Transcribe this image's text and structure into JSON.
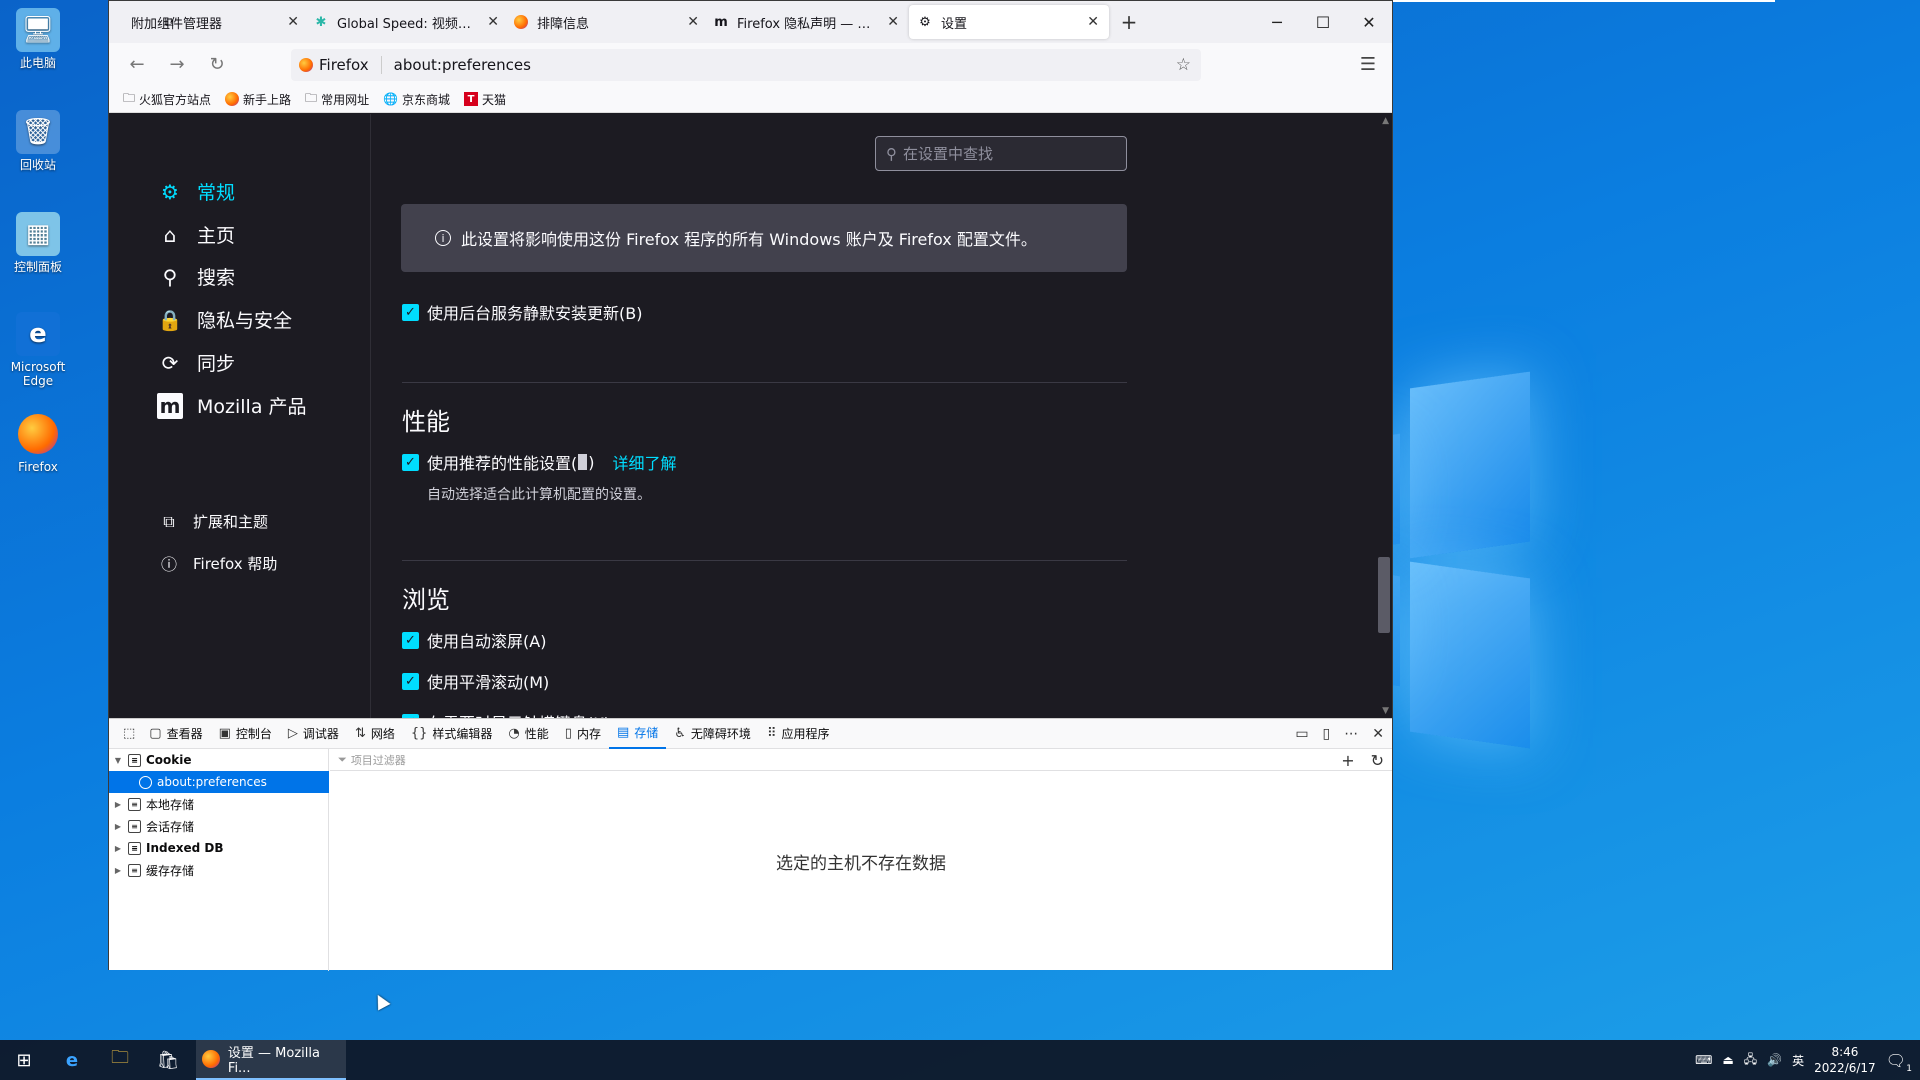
{
  "desktop": {
    "icons": [
      {
        "label": "此电脑",
        "icon": "computer-icon"
      },
      {
        "label": "回收站",
        "icon": "recycle-bin-icon"
      },
      {
        "label": "控制面板",
        "icon": "control-panel-icon"
      },
      {
        "label": "Microsoft Edge",
        "icon": "edge-icon"
      },
      {
        "label": "Firefox",
        "icon": "firefox-icon"
      }
    ]
  },
  "browser": {
    "tabs": [
      {
        "label": "附加组件管理器",
        "icon": "puzzle-icon"
      },
      {
        "label": "Global Speed: 视频速度控制",
        "icon": "global-speed-icon"
      },
      {
        "label": "排障信息",
        "icon": "firefox-icon"
      },
      {
        "label": "Firefox 隐私声明 — Mozilla",
        "icon": "mozilla-icon"
      },
      {
        "label": "设置",
        "icon": "gear-icon"
      }
    ],
    "url_identity": "Firefox",
    "url": "about:preferences",
    "bookmarks": [
      {
        "label": "火狐官方站点",
        "icon": "folder-icon"
      },
      {
        "label": "新手上路",
        "icon": "firefox-icon"
      },
      {
        "label": "常用网址",
        "icon": "folder-icon"
      },
      {
        "label": "京东商城",
        "icon": "globe-icon"
      },
      {
        "label": "天猫",
        "icon": "tmall-icon"
      }
    ]
  },
  "settings": {
    "nav": [
      {
        "label": "常规",
        "icon": "gear-icon",
        "active": true
      },
      {
        "label": "主页",
        "icon": "home-icon"
      },
      {
        "label": "搜索",
        "icon": "search-icon"
      },
      {
        "label": "隐私与安全",
        "icon": "lock-icon"
      },
      {
        "label": "同步",
        "icon": "sync-icon"
      },
      {
        "label": "Mozilla 产品",
        "icon": "mozilla-icon"
      }
    ],
    "nav_footer": [
      {
        "label": "扩展和主题",
        "icon": "puzzle-icon"
      },
      {
        "label": "Firefox 帮助",
        "icon": "help-icon"
      }
    ],
    "search_placeholder": "在设置中查找",
    "info_text": "此设置将影响使用这份 Firefox 程序的所有 Windows 账户及 Firefox 配置文件。",
    "bg_update_label": "使用后台服务静默安装更新(B)",
    "performance_title": "性能",
    "perf_recommended_label": "使用推荐的性能设置(",
    "perf_recommended_suffix": ")",
    "learn_more": "详细了解",
    "perf_subtext": "自动选择适合此计算机配置的设置。",
    "browsing_title": "浏览",
    "autoscroll_label": "使用自动滚屏(A)",
    "smooth_scroll_label": "使用平滑滚动(M)",
    "touch_keyboard_label": "在需要时显示触摸键盘(K)"
  },
  "devtools": {
    "tabs": [
      {
        "label": "查看器",
        "icon": "inspector-icon"
      },
      {
        "label": "控制台",
        "icon": "console-icon"
      },
      {
        "label": "调试器",
        "icon": "debugger-icon"
      },
      {
        "label": "网络",
        "icon": "network-icon"
      },
      {
        "label": "样式编辑器",
        "icon": "style-editor-icon"
      },
      {
        "label": "性能",
        "icon": "performance-icon"
      },
      {
        "label": "内存",
        "icon": "memory-icon"
      },
      {
        "label": "存储",
        "icon": "storage-icon",
        "active": true
      },
      {
        "label": "无障碍环境",
        "icon": "accessibility-icon"
      },
      {
        "label": "应用程序",
        "icon": "application-icon"
      }
    ],
    "tree": [
      {
        "label": "Cookie",
        "expanded": true
      },
      {
        "label": "about:preferences",
        "selected": true
      },
      {
        "label": "本地存储"
      },
      {
        "label": "会话存储"
      },
      {
        "label": "Indexed DB"
      },
      {
        "label": "缓存存储"
      }
    ],
    "filter_placeholder": "项目过滤器",
    "empty_message": "选定的主机不存在数据"
  },
  "taskbar": {
    "app_label": "设置 — Mozilla Fi...",
    "ime": "英",
    "time": "8:46",
    "date": "2022/6/17",
    "notification_count": "1"
  },
  "colors": {
    "accent": "#00ddff",
    "settings_bg": "#1c1b22",
    "devtools_accent": "#0074e8"
  }
}
